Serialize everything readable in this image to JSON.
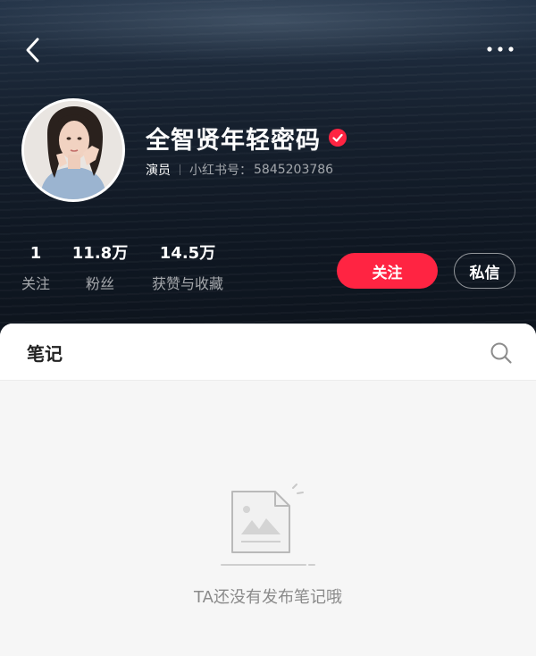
{
  "header": {
    "back_icon": "chevron-left-icon",
    "more_icon": "more-dots-icon"
  },
  "profile": {
    "name": "全智贤年轻密码",
    "verified_icon": "verified-badge-icon",
    "role": "演员",
    "redbook_id_label": "小红书号：",
    "redbook_id": "5845203786"
  },
  "stats": [
    {
      "value": "1",
      "label": "关注"
    },
    {
      "value": "11.8万",
      "label": "粉丝"
    },
    {
      "value": "14.5万",
      "label": "获赞与收藏"
    }
  ],
  "actions": {
    "follow_label": "关注",
    "message_label": "私信"
  },
  "tabs": {
    "notes_label": "笔记",
    "search_icon": "search-icon"
  },
  "empty_state": {
    "illustration_icon": "empty-document-icon",
    "message": "TA还没有发布笔记哦"
  },
  "colors": {
    "accent": "#ff2442",
    "hero_bg": "#16202e",
    "sheet_bg": "#f6f6f6"
  }
}
